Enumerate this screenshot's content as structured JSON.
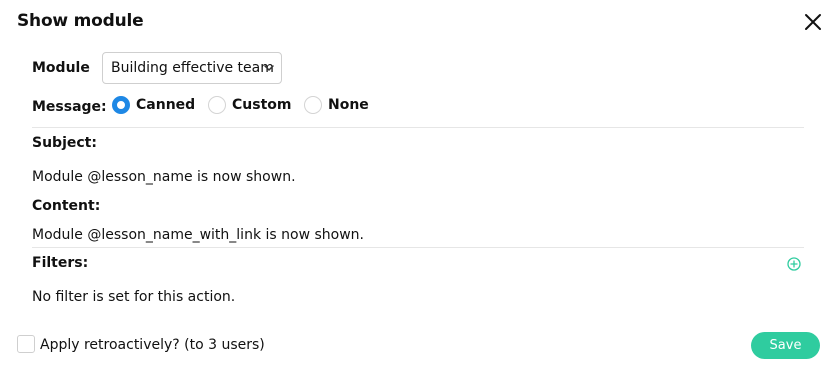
{
  "dialog": {
    "title": "Show module",
    "close_icon": "close-icon"
  },
  "module": {
    "label": "Module",
    "selected": "Building effective team"
  },
  "message": {
    "label": "Message:",
    "options": [
      "Canned",
      "Custom",
      "None"
    ],
    "selected": "Canned"
  },
  "subject": {
    "label": "Subject:",
    "value": "Module @lesson_name is now shown."
  },
  "content": {
    "label": "Content:",
    "value": "Module @lesson_name_with_link is now shown."
  },
  "filters": {
    "label": "Filters:",
    "empty_text": "No filter is set for this action.",
    "add_icon": "plus-circle-icon"
  },
  "footer": {
    "retro_label": "Apply retroactively? (to 3 users)",
    "save_label": "Save"
  },
  "colors": {
    "accent_blue": "#1e88e5",
    "save_green": "#2fcc9f",
    "add_icon_green": "#2fcc9f"
  }
}
